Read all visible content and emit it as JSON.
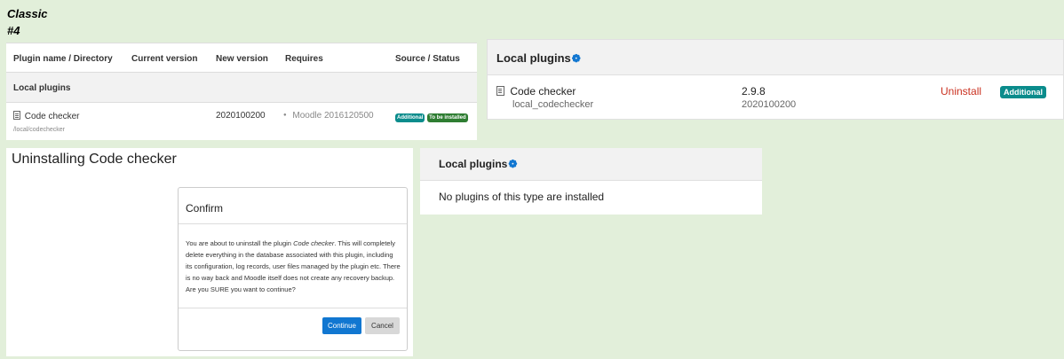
{
  "label": {
    "line1": "Classic",
    "line2": "#4"
  },
  "classic": {
    "headers": {
      "name": "Plugin name / Directory",
      "current": "Current version",
      "new": "New version",
      "requires": "Requires",
      "source": "Source / Status"
    },
    "section_title": "Local plugins",
    "plugin": {
      "name": "Code checker",
      "directory": "/local/codechecker",
      "new_version": "2020100200",
      "requires": "Moodle 2016120500",
      "badge_additional": "Additional",
      "badge_status": "To be installed"
    }
  },
  "boost": {
    "title": "Local plugins",
    "plugin": {
      "name": "Code checker",
      "component": "local_codechecker",
      "release": "2.9.8",
      "version": "2020100200",
      "uninstall_label": "Uninstall",
      "badge_additional": "Additional"
    }
  },
  "uninstall": {
    "page_title": "Uninstalling Code checker",
    "dialog_title": "Confirm",
    "message_pre": "You are about to uninstall the plugin ",
    "message_plugin": "Code checker",
    "message_post": ". This will completely delete everything in the database associated with this plugin, including its configuration, log records, user files managed by the plugin etc. There is no way back and Moodle itself does not create any recovery backup. Are you SURE you want to continue?",
    "continue_label": "Continue",
    "cancel_label": "Cancel"
  },
  "empty": {
    "title": "Local plugins",
    "message": "No plugins of this type are installed"
  },
  "colors": {
    "background": "#e2efda",
    "primary": "#1177d1",
    "badge_info": "#0a8c8c",
    "badge_success": "#2e7d32",
    "uninstall": "#ca3120"
  },
  "icons": {
    "settings": "gear-icon",
    "plugin": "file-icon"
  }
}
